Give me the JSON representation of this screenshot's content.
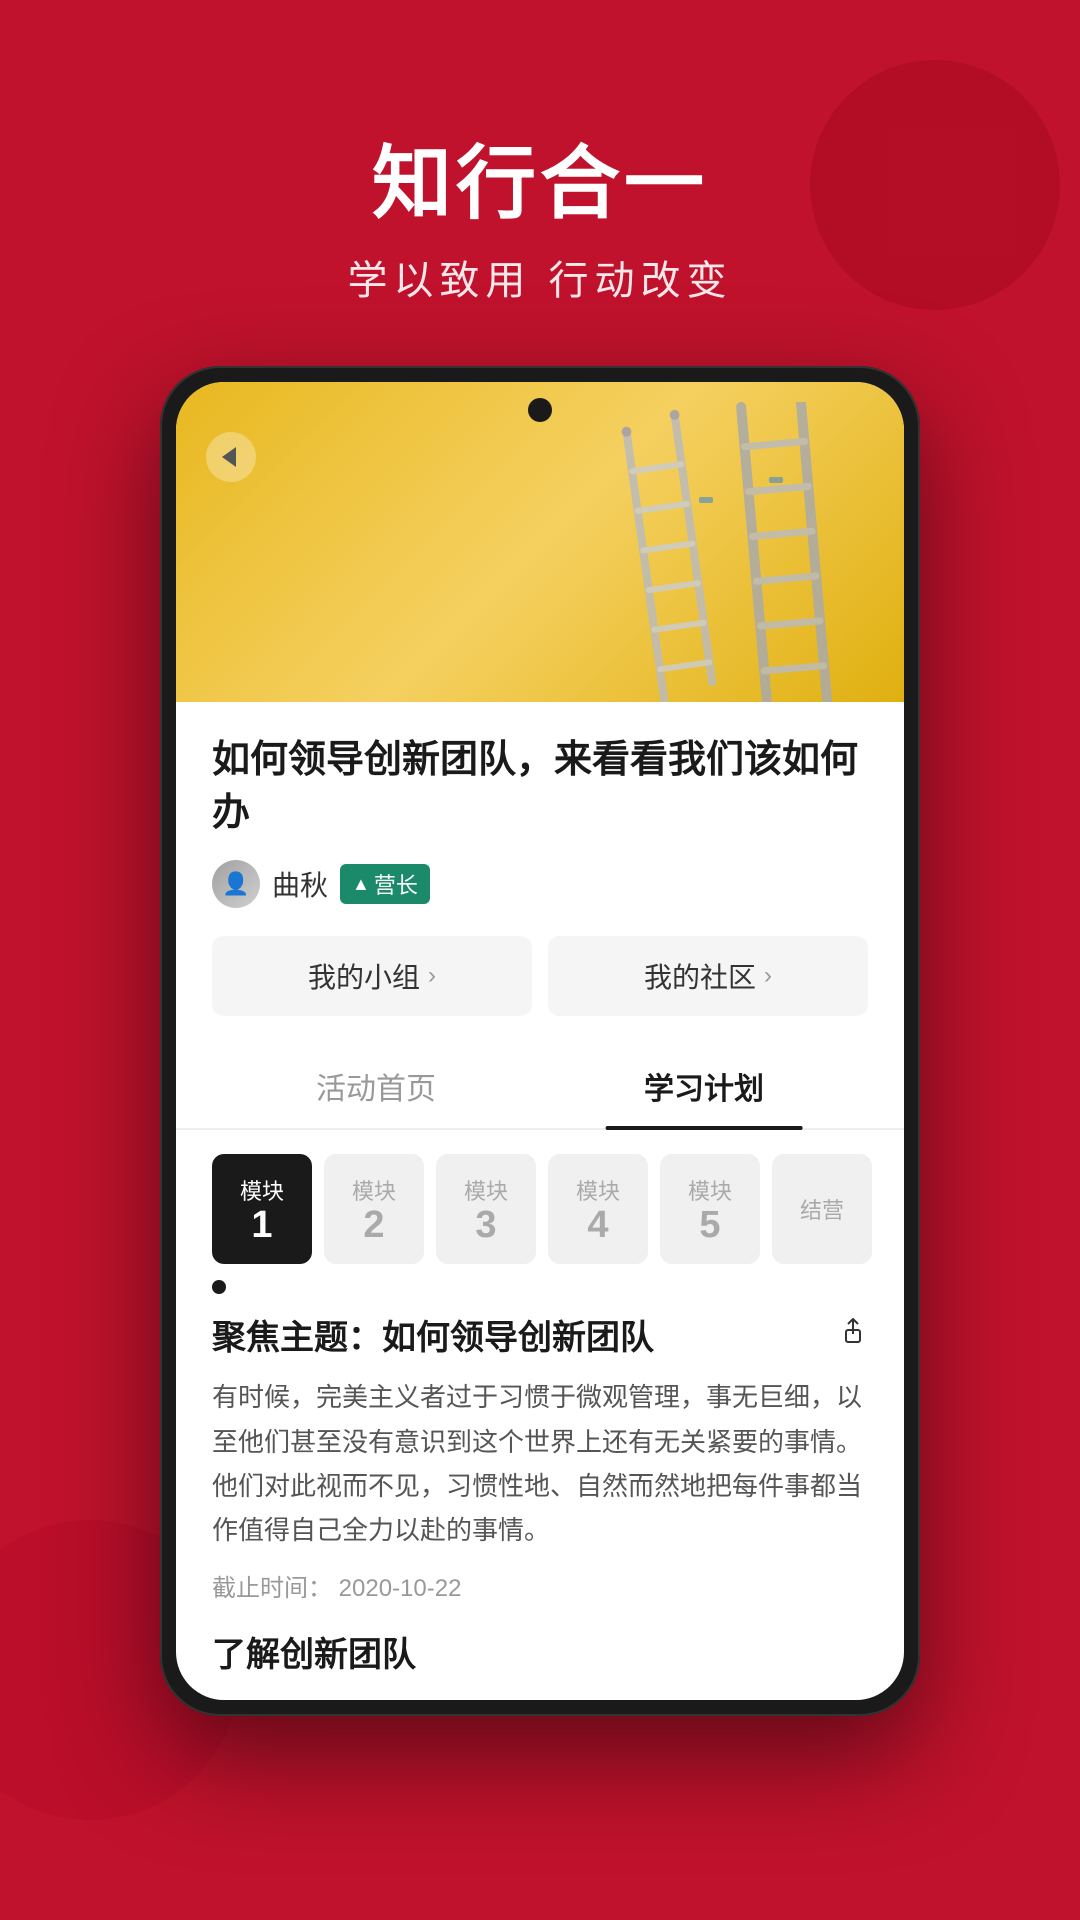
{
  "hero": {
    "title": "知行合一",
    "subtitle": "学以致用 行动改变"
  },
  "article": {
    "image_alt": "黄色墙壁与梯子",
    "title": "如何领导创新团队，来看看我们该如何办",
    "author": {
      "name": "曲秋",
      "badge_text": "营长",
      "badge_icon": "▲"
    }
  },
  "nav_buttons": [
    {
      "label": "我的小组",
      "arrow": ">"
    },
    {
      "label": "我的社区",
      "arrow": ">"
    }
  ],
  "tabs": [
    {
      "id": "activity",
      "label": "活动首页",
      "active": false
    },
    {
      "id": "plan",
      "label": "学习计划",
      "active": true
    }
  ],
  "modules": [
    {
      "label": "模块",
      "num": "1",
      "active": true
    },
    {
      "label": "模块",
      "num": "2",
      "active": false
    },
    {
      "label": "模块",
      "num": "3",
      "active": false
    },
    {
      "label": "模块",
      "num": "4",
      "active": false
    },
    {
      "label": "模块",
      "num": "5",
      "active": false
    },
    {
      "label": "结营",
      "num": "",
      "active": false
    }
  ],
  "focus": {
    "title": "聚焦主题：如何领导创新团队",
    "body": "有时候，完美主义者过于习惯于微观管理，事无巨细，以至他们甚至没有意识到这个世界上还有无关紧要的事情。他们对此视而不见，习惯性地、自然而然地把每件事都当作值得自己全力以赴的事情。",
    "deadline_label": "截止时间：",
    "deadline": "2020-10-22",
    "section_title": "了解创新团队"
  },
  "back_button_label": "‹"
}
